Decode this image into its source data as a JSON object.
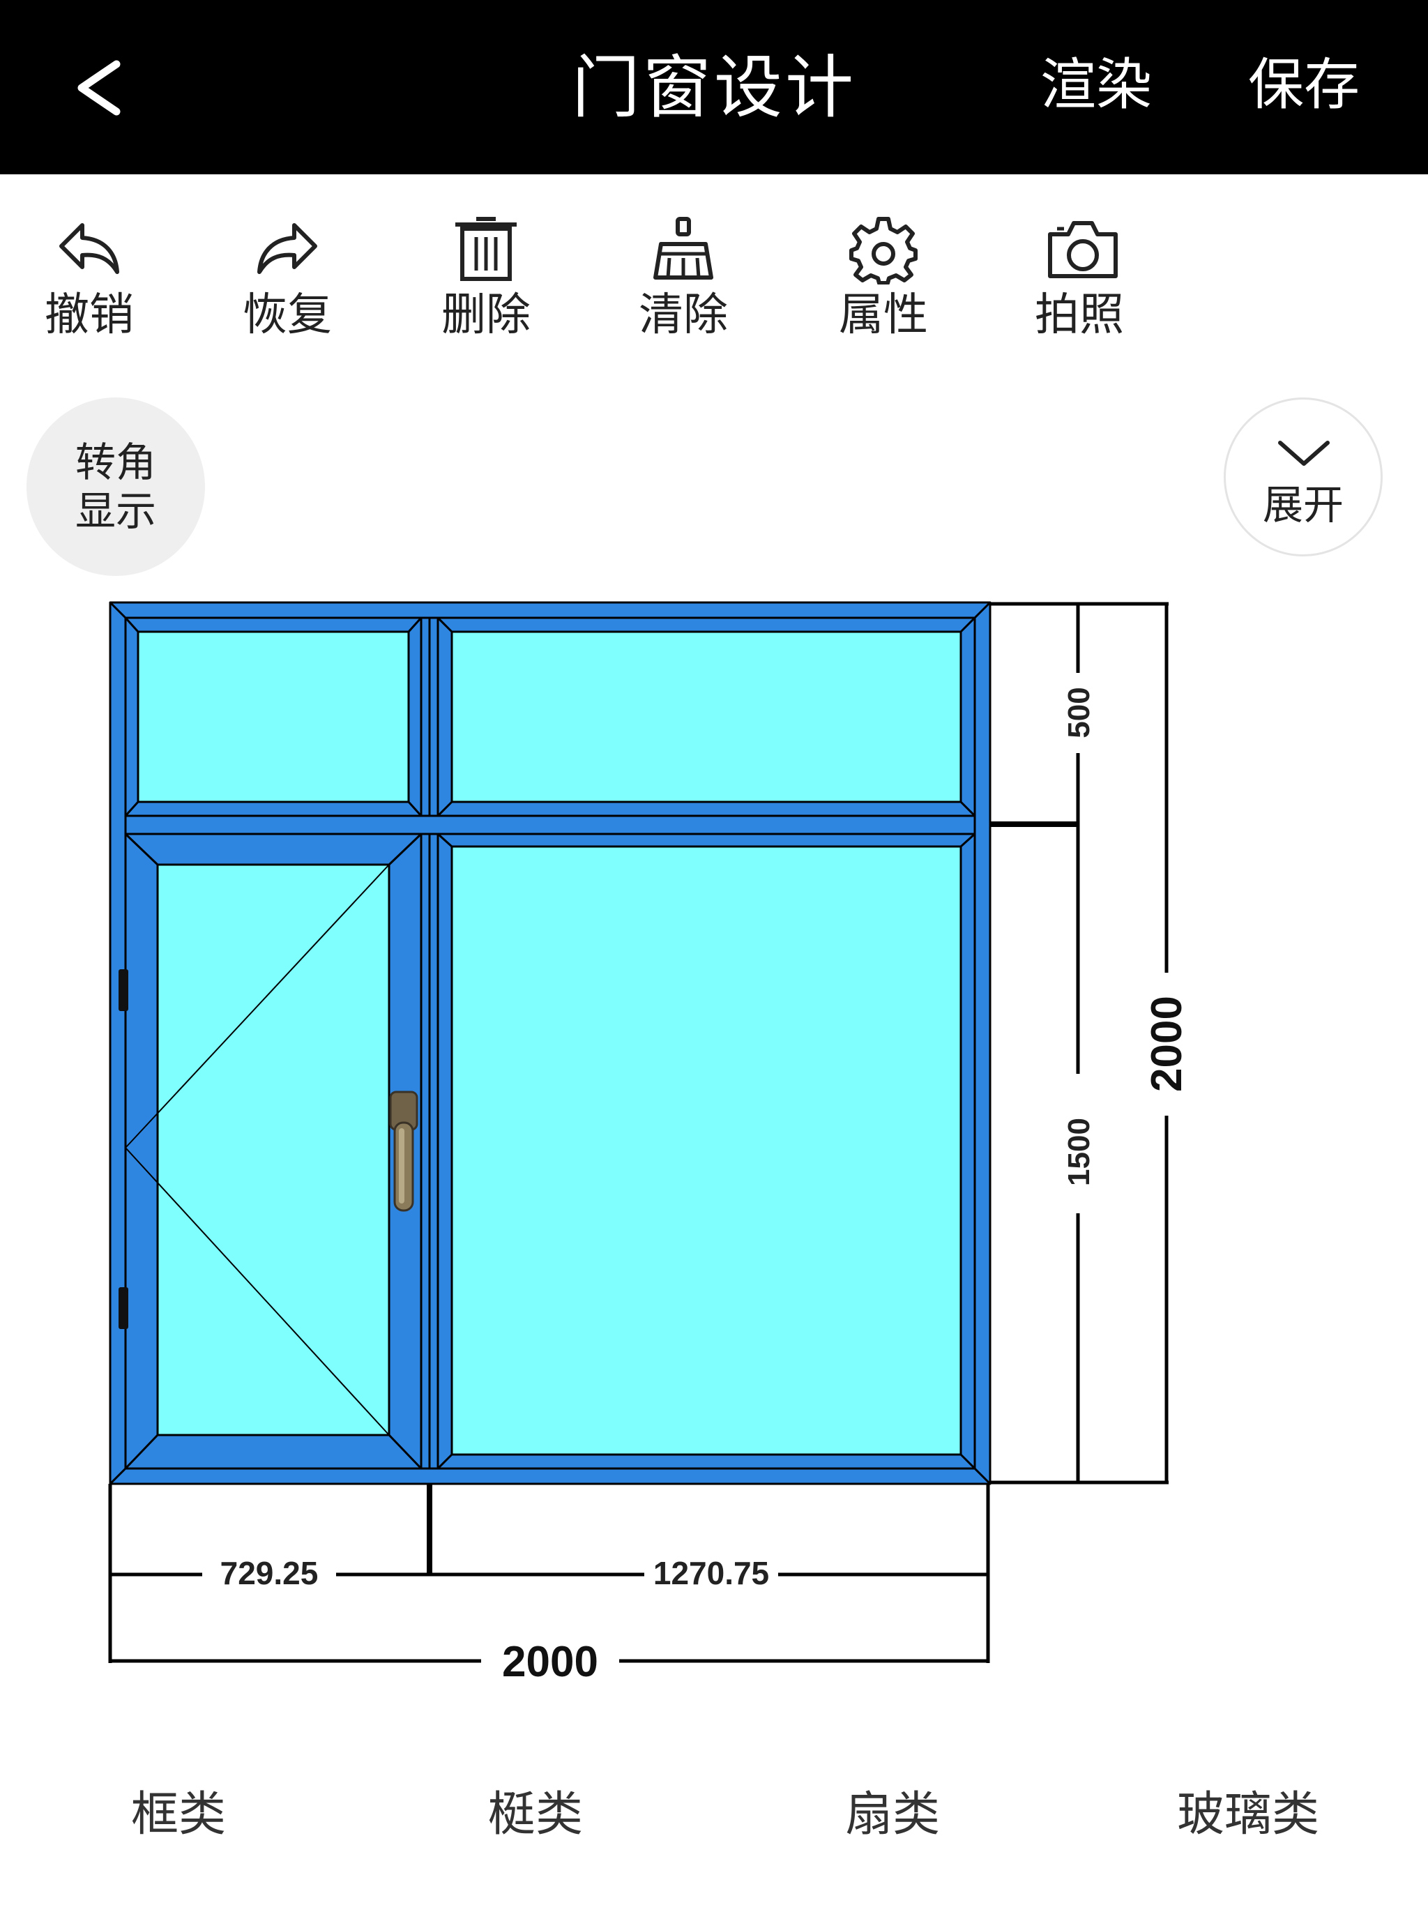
{
  "header": {
    "title": "门窗设计",
    "back_icon": "back-chevron-icon",
    "render_label": "渲染",
    "save_label": "保存"
  },
  "toolbar": {
    "items": [
      {
        "label": "撤销",
        "icon": "undo-icon"
      },
      {
        "label": "恢复",
        "icon": "redo-icon"
      },
      {
        "label": "删除",
        "icon": "trash-icon"
      },
      {
        "label": "清除",
        "icon": "broom-icon"
      },
      {
        "label": "属性",
        "icon": "gear-icon"
      },
      {
        "label": "拍照",
        "icon": "camera-icon"
      }
    ]
  },
  "canvas": {
    "corner_toggle": {
      "line1": "转角",
      "line2": "显示"
    },
    "expand_button": {
      "label": "展开",
      "icon": "chevron-down-icon"
    }
  },
  "window_design": {
    "frame_color": "#2f86e0",
    "glass_color": "#80ffff",
    "dimensions": {
      "widths": {
        "left": "729.25",
        "right": "1270.75",
        "total": "2000"
      },
      "heights": {
        "top": "500",
        "bottom": "1500",
        "total": "2000"
      }
    },
    "components": [
      "fixed-transom-left",
      "fixed-transom-right",
      "casement-sash-left",
      "fixed-glass-right"
    ]
  },
  "bottom_tabs": [
    {
      "label": "框类"
    },
    {
      "label": "梃类"
    },
    {
      "label": "扇类"
    },
    {
      "label": "玻璃类"
    }
  ]
}
